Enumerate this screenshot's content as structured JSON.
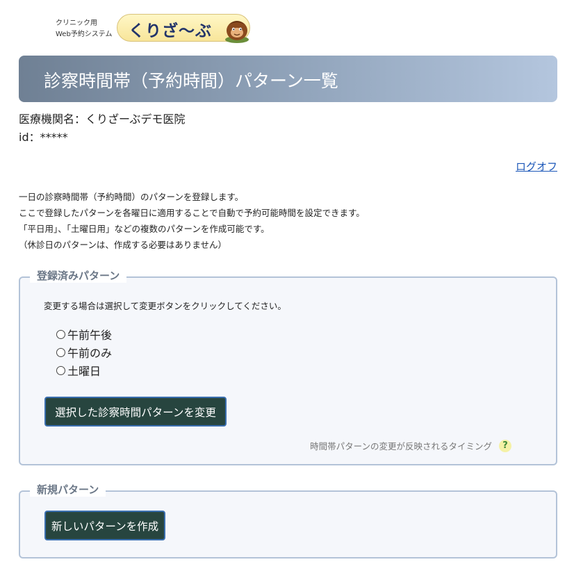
{
  "logo": {
    "sub_line1": "クリニック用",
    "sub_line2": "Web予約システム",
    "name": "くりざ〜ぶ"
  },
  "page_title": "診察時間帯（予約時間）パターン一覧",
  "clinic": {
    "label": "医療機関名：くりざーぶデモ医院",
    "id_label": "id：*****"
  },
  "logoff_label": "ログオフ",
  "intro": [
    "一日の診察時間帯（予約時間）のパターンを登録します。",
    "ここで登録したパターンを各曜日に適用することで自動で予約可能時間を設定できます。",
    "「平日用」、「土曜日用」などの複数のパターンを作成可能です。",
    "（休診日のパターンは、作成する必要はありません）"
  ],
  "registered": {
    "legend": "登録済みパターン",
    "instruction": "変更する場合は選択して変更ボタンをクリックしてください。",
    "patterns": [
      "午前午後",
      "午前のみ",
      "土曜日"
    ],
    "change_button": "選択した診察時間パターンを変更",
    "timing_note": "時間帯パターンの変更が反映されるタイミング",
    "help_icon_glyph": "?"
  },
  "new_pattern": {
    "legend": "新規パターン",
    "create_button": "新しいパターンを作成"
  },
  "colors": {
    "button_bg": "#27453f",
    "button_border": "#3a6fb0",
    "link": "#1a56b8",
    "box_border": "#b3c3d8"
  }
}
